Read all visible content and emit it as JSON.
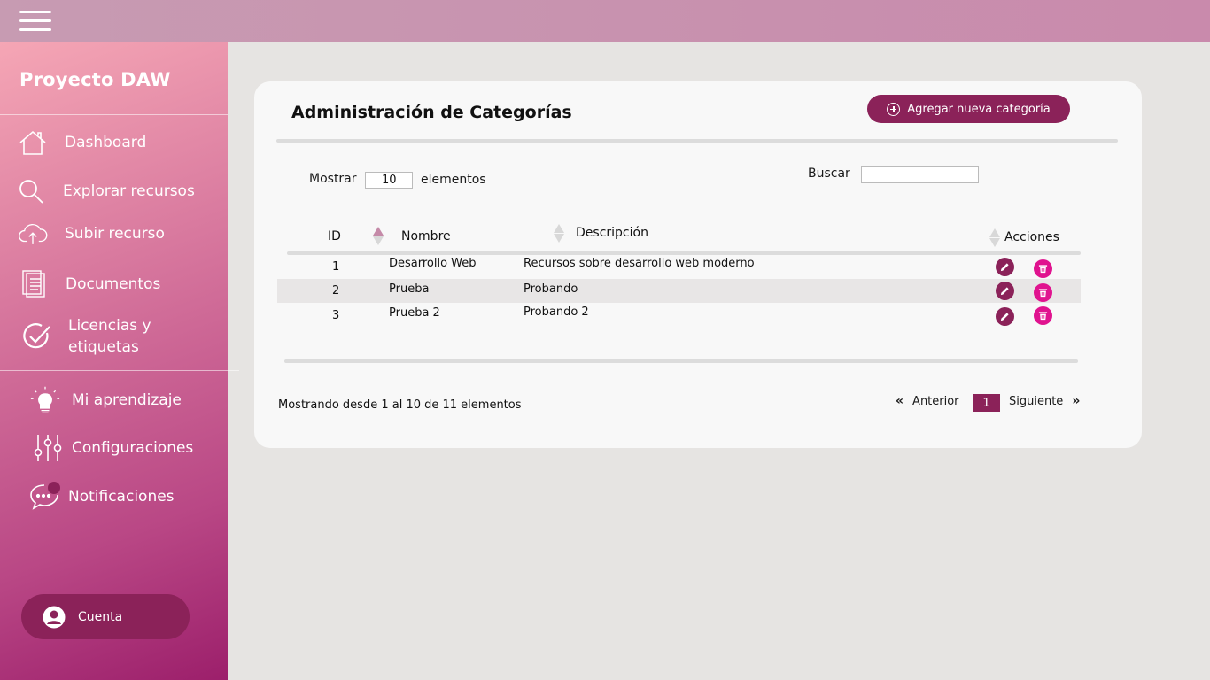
{
  "topbar": {
    "menu_icon": "hamburger-menu-icon"
  },
  "sidebar": {
    "brand": "Proyecto DAW",
    "items": [
      {
        "label": "Dashboard",
        "icon": "home-icon"
      },
      {
        "label": "Explorar recursos",
        "icon": "search-icon"
      },
      {
        "label": "Subir recurso",
        "icon": "cloud-upload-icon"
      },
      {
        "label": "Documentos",
        "icon": "documents-icon"
      },
      {
        "label": "Licencias y etiquetas",
        "icon": "check-circle-icon"
      },
      {
        "label": "Mi aprendizaje",
        "icon": "lightbulb-icon"
      },
      {
        "label": "Configuraciones",
        "icon": "sliders-icon"
      },
      {
        "label": "Notificaciones",
        "icon": "chat-bubble-icon"
      }
    ],
    "account_label": "Cuenta"
  },
  "colors": {
    "accent": "#8b2259",
    "delete": "#e0138f",
    "card": "#f8f8f8",
    "background": "#e6e4e2"
  },
  "main": {
    "title": "Administración de Categorías",
    "add_button": "Agregar nueva categoría",
    "show_label": "Mostrar",
    "show_value": "10",
    "elements_label": "elementos",
    "search_label": "Buscar",
    "search_value": "",
    "columns": {
      "id": "ID",
      "name": "Nombre",
      "description": "Descripción",
      "actions": "Acciones"
    },
    "rows": [
      {
        "id": "1",
        "name": "Desarrollo Web",
        "description": "Recursos sobre desarrollo web moderno"
      },
      {
        "id": "2",
        "name": "Prueba",
        "description": "Probando"
      },
      {
        "id": "3",
        "name": "Prueba 2",
        "description": "Probando 2"
      }
    ],
    "footer": "Mostrando desde 1 al 10 de 11 elementos",
    "pagination": {
      "prev": "Anterior",
      "current": "1",
      "next": "Siguiente"
    }
  }
}
